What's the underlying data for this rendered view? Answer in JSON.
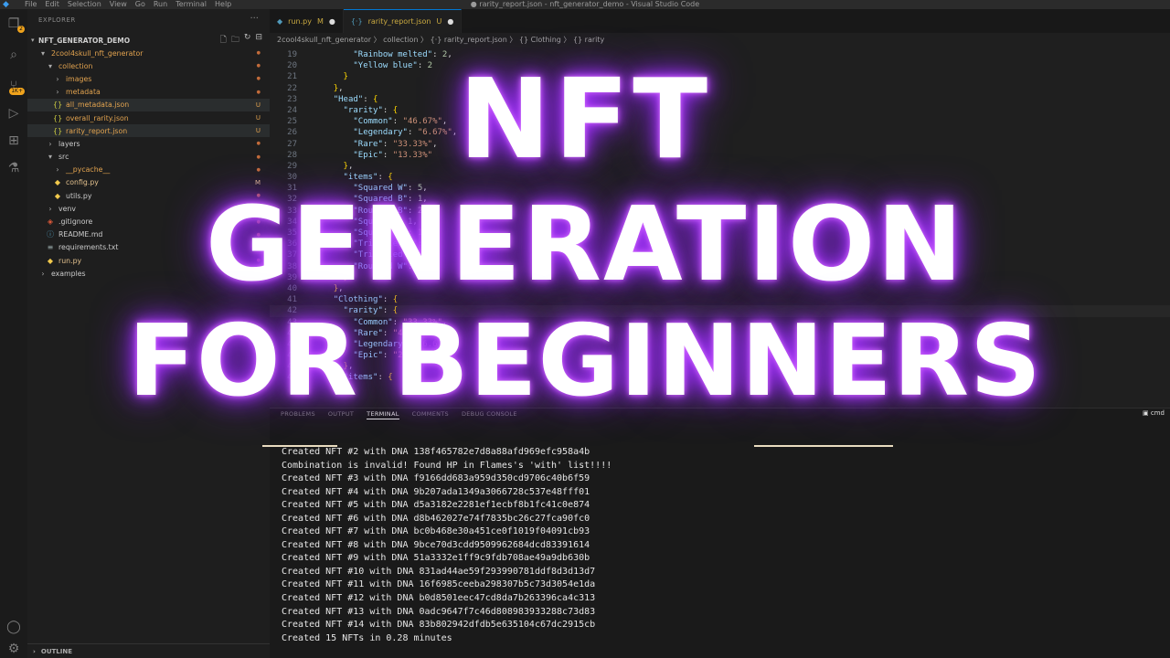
{
  "titlebar": {
    "menu": [
      "File",
      "Edit",
      "Selection",
      "View",
      "Go",
      "Run",
      "Terminal",
      "Help"
    ],
    "window_title": "● rarity_report.json - nft_generator_demo - Visual Studio Code"
  },
  "activity": {
    "scm_badge": "2",
    "ext_badge": "1K+"
  },
  "sidebar": {
    "title": "EXPLORER",
    "project": "NFT_GENERATOR_DEMO",
    "outline": "OUTLINE",
    "tree": [
      {
        "label": "2cool4skull_nft_generator",
        "status": "",
        "depth": 0,
        "kind": "folder-open",
        "color": "#e2a34f"
      },
      {
        "label": "collection",
        "status": "",
        "depth": 1,
        "kind": "folder-open",
        "color": "#e2a34f"
      },
      {
        "label": "images",
        "status": "",
        "depth": 2,
        "kind": "folder",
        "color": "#e2a34f"
      },
      {
        "label": "metadata",
        "status": "",
        "depth": 2,
        "kind": "folder",
        "color": "#e2a34f"
      },
      {
        "label": "all_metadata.json",
        "status": "U",
        "depth": 2,
        "kind": "json",
        "color": "#e2a34f"
      },
      {
        "label": "overall_rarity.json",
        "status": "U",
        "depth": 2,
        "kind": "json",
        "color": "#e2a34f"
      },
      {
        "label": "rarity_report.json",
        "status": "U",
        "depth": 2,
        "kind": "json",
        "color": "#e2a34f"
      },
      {
        "label": "layers",
        "status": "",
        "depth": 1,
        "kind": "folder",
        "color": "#cccccc"
      },
      {
        "label": "src",
        "status": "",
        "depth": 1,
        "kind": "folder-open",
        "color": "#cccccc"
      },
      {
        "label": "__pycache__",
        "status": "",
        "depth": 2,
        "kind": "folder",
        "color": "#e2a34f"
      },
      {
        "label": "config.py",
        "status": "M",
        "depth": 2,
        "kind": "py",
        "color": "#e2c08d"
      },
      {
        "label": "utils.py",
        "status": "",
        "depth": 2,
        "kind": "py",
        "color": "#cccccc"
      },
      {
        "label": "venv",
        "status": "",
        "depth": 1,
        "kind": "folder",
        "color": "#cccccc"
      },
      {
        "label": ".gitignore",
        "status": "",
        "depth": 1,
        "kind": "git",
        "color": "#cccccc"
      },
      {
        "label": "README.md",
        "status": "",
        "depth": 1,
        "kind": "info",
        "color": "#cccccc"
      },
      {
        "label": "requirements.txt",
        "status": "",
        "depth": 1,
        "kind": "txt",
        "color": "#cccccc"
      },
      {
        "label": "run.py",
        "status": "",
        "depth": 1,
        "kind": "py",
        "color": "#e2c08d"
      },
      {
        "label": "examples",
        "status": "",
        "depth": 0,
        "kind": "folder",
        "color": "#cccccc"
      }
    ]
  },
  "editor": {
    "tabs": [
      {
        "label": "run.py",
        "status": "M",
        "active": false
      },
      {
        "label": "rarity_report.json",
        "status": "U",
        "active": true
      }
    ],
    "breadcrumb": "2cool4skull_nft_generator 〉 collection 〉 {·} rarity_report.json 〉 {} Clothing 〉 {} rarity",
    "lines": [
      {
        "n": "19",
        "text": "        \"Rainbow melted\": 2,"
      },
      {
        "n": "20",
        "text": "        \"Yellow blue\": 2"
      },
      {
        "n": "21",
        "text": "      }"
      },
      {
        "n": "22",
        "text": "    },"
      },
      {
        "n": "23",
        "text": "    \"Head\": {"
      },
      {
        "n": "24",
        "text": "      \"rarity\": {"
      },
      {
        "n": "25",
        "text": "        \"Common\": \"46.67%\","
      },
      {
        "n": "26",
        "text": "        \"Legendary\": \"6.67%\","
      },
      {
        "n": "27",
        "text": "        \"Rare\": \"33.33%\","
      },
      {
        "n": "28",
        "text": "        \"Epic\": \"13.33%\""
      },
      {
        "n": "29",
        "text": "      },"
      },
      {
        "n": "30",
        "text": "      \"items\": {"
      },
      {
        "n": "31",
        "text": "        \"Squared W\": 5,"
      },
      {
        "n": "32",
        "text": "        \"Squared B\": 1,"
      },
      {
        "n": "33",
        "text": "        \"Rounded B\": 2,"
      },
      {
        "n": "34",
        "text": "        \"Squared\": 1,"
      },
      {
        "n": "35",
        "text": "        \"Squared B\": 1,"
      },
      {
        "n": "36",
        "text": "        \"Triangled W\": 1,"
      },
      {
        "n": "37",
        "text": "        \"Triangled B\": 1,"
      },
      {
        "n": "38",
        "text": "        \"Rounded W\": 1"
      },
      {
        "n": "39",
        "text": "      }"
      },
      {
        "n": "40",
        "text": "    },"
      },
      {
        "n": "41",
        "text": "    \"Clothing\": {"
      },
      {
        "n": "42",
        "text": "      \"rarity\": {"
      },
      {
        "n": "43",
        "text": "        \"Common\": \"33.33%\","
      },
      {
        "n": "44",
        "text": "        \"Rare\": \"40%\","
      },
      {
        "n": "45",
        "text": "        \"Legendary\": \"6.67%\","
      },
      {
        "n": "46",
        "text": "        \"Epic\": \"20%\""
      },
      {
        "n": "47",
        "text": "      },"
      },
      {
        "n": "48",
        "text": "      \"items\": {"
      }
    ]
  },
  "panel": {
    "tabs": [
      "PROBLEMS",
      "OUTPUT",
      "TERMINAL",
      "COMMENTS",
      "DEBUG CONSOLE"
    ],
    "active_tab": "TERMINAL",
    "shell": "cmd",
    "terminal_lines": [
      "Created NFT #2 with DNA 138f465782e7d8a88afd969efc958a4b",
      "Combination is invalid! Found HP in Flames's 'with' list!!!!",
      "Created NFT #3 with DNA f9166dd683a959d350cd9706c40b6f59",
      "Created NFT #4 with DNA 9b207ada1349a3066728c537e48fff01",
      "Created NFT #5 with DNA d5a3182e2281ef1ecbf8b1fc41c0e874",
      "Created NFT #6 with DNA d8b462027e74f7835bc26c27fca90fc0",
      "Created NFT #7 with DNA bc0b468e30a451ce0f1019f04091cb93",
      "Created NFT #8 with DNA 9bce70d3cdd9509962684dcd83391614",
      "Created NFT #9 with DNA 51a3332e1ff9c9fdb708ae49a9db630b",
      "Created NFT #10 with DNA 831ad44ae59f293990781ddf8d3d13d7",
      "Created NFT #11 with DNA 16f6985ceeba298307b5c73d3054e1da",
      "Created NFT #12 with DNA b0d8501eec47cd8da7b263396ca4c313",
      "Created NFT #13 with DNA 0adc9647f7c46d808983933288c73d83",
      "Created NFT #14 with DNA 83b802942dfdb5e635104c67dc2915cb",
      "Created 15 NFTs in 0.28 minutes"
    ]
  },
  "overlay": {
    "line1": "NFT",
    "line2": "GENERATION",
    "line3": "FOR BEGINNERS",
    "glow_color": "#b440ff"
  }
}
